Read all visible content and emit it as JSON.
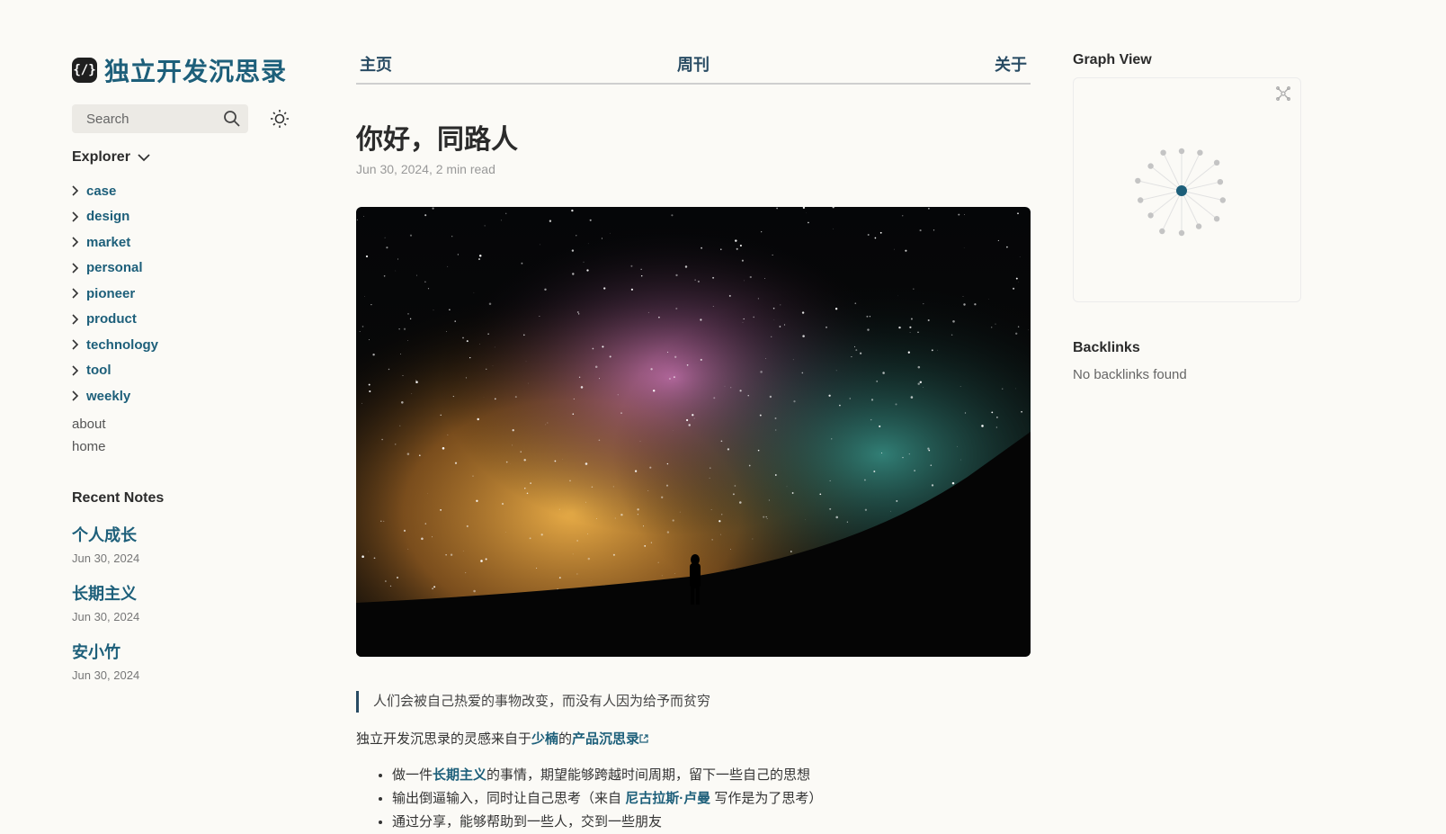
{
  "site": {
    "logo_glyph": "{/}",
    "title": "独立开发沉思录"
  },
  "search": {
    "placeholder": "Search"
  },
  "explorer": {
    "label": "Explorer",
    "folders": [
      "case",
      "design",
      "market",
      "personal",
      "pioneer",
      "product",
      "technology",
      "tool",
      "weekly"
    ],
    "pages": [
      "about",
      "home"
    ]
  },
  "recent": {
    "label": "Recent Notes",
    "items": [
      {
        "title": "个人成长",
        "date": "Jun 30, 2024"
      },
      {
        "title": "长期主义",
        "date": "Jun 30, 2024"
      },
      {
        "title": "安小竹",
        "date": "Jun 30, 2024"
      }
    ]
  },
  "nav": {
    "home": "主页",
    "weekly": "周刊",
    "about": "关于"
  },
  "article": {
    "title": "你好，同路人",
    "meta": "Jun 30, 2024,  2 min read",
    "quote": "人们会被自己热爱的事物改变，而没有人因为给予而贫穷",
    "intro": {
      "a": "独立开发沉思录的灵感来自于",
      "link1": "少楠",
      "b": "的",
      "link2": "产品沉思录"
    },
    "bullets": [
      {
        "a": "做一件",
        "link": "长期主义",
        "b": "的事情，期望能够跨越时间周期，留下一些自己的思想"
      },
      {
        "a": "输出倒逼输入，同时让自己思考（来自",
        "link": "尼古拉斯·卢曼",
        "b": "写作是为了思考）"
      },
      {
        "a": "通过分享，能够帮助到一些人，交到一些朋友",
        "link": "",
        "b": ""
      }
    ]
  },
  "graph": {
    "label": "Graph View",
    "nodes": 14
  },
  "backlinks": {
    "label": "Backlinks",
    "empty": "No backlinks found"
  },
  "colors": {
    "accent": "#1d5f7a",
    "background": "#fbfaf6"
  }
}
